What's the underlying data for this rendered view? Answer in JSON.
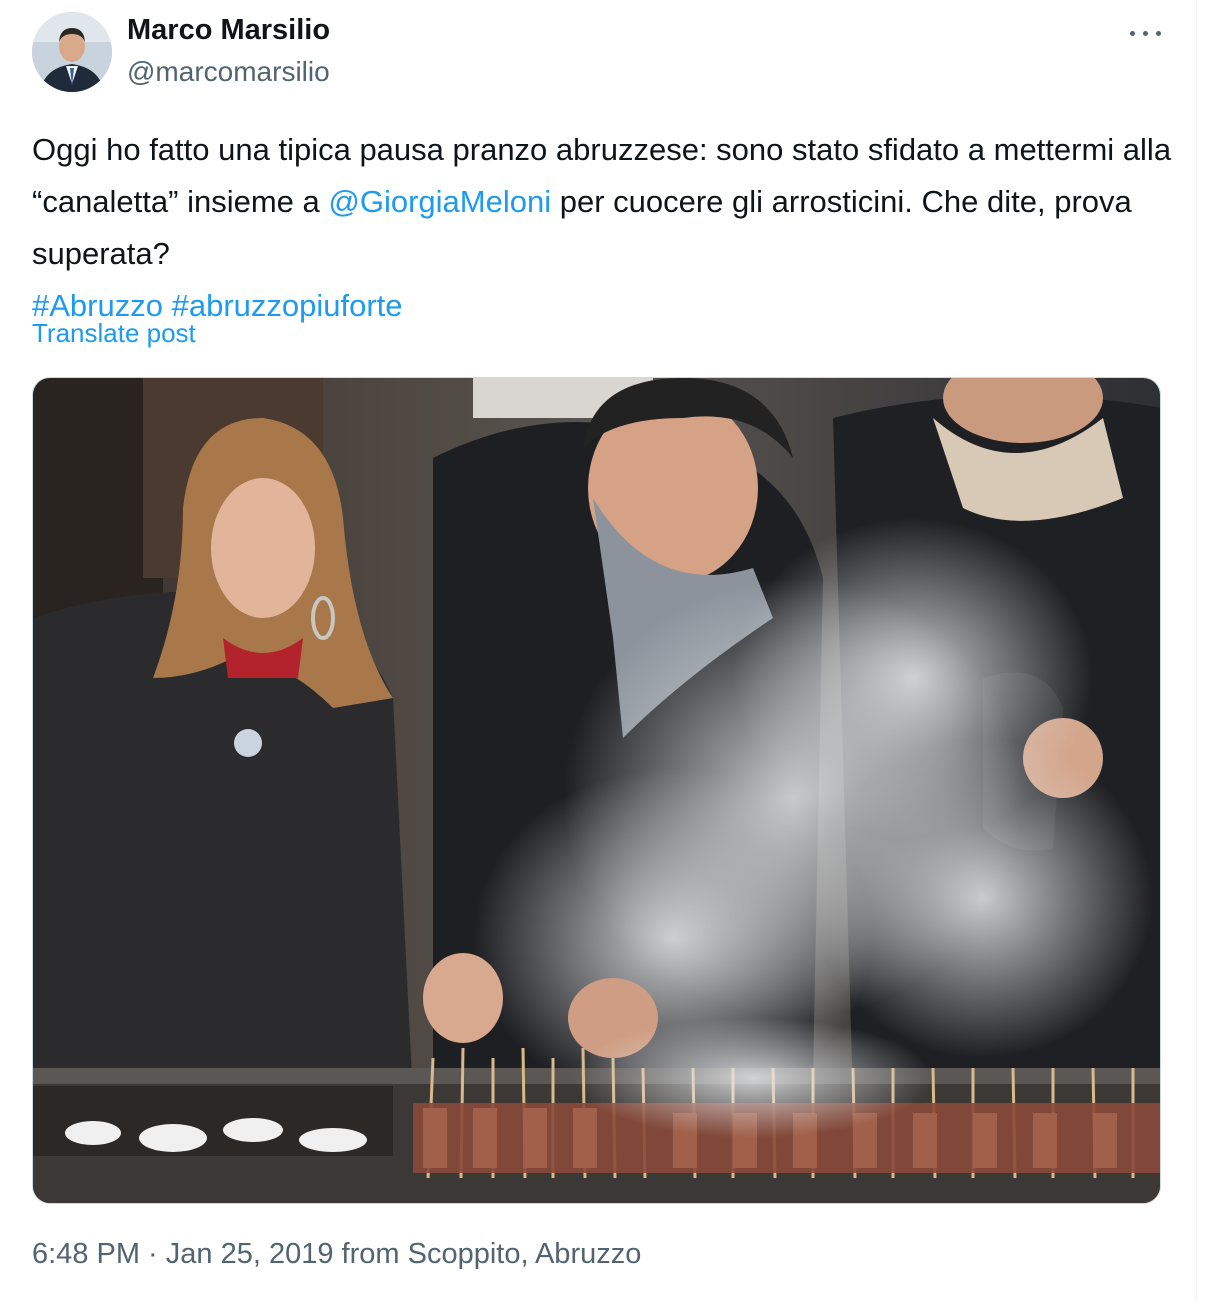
{
  "author": {
    "name": "Marco Marsilio",
    "handle": "@marcomarsilio"
  },
  "tweet": {
    "text_part1": "Oggi ho fatto una tipica pausa pranzo abruzzese: sono stato sfidato a mettermi alla “canaletta” insieme a ",
    "mention": "@GiorgiaMeloni",
    "text_part2": " per cuocere gli arrosticini. Che dite, prova superata?",
    "hashtag1": "#Abruzzo",
    "hashtag2": "#abruzzopiuforte",
    "translate_label": "Translate post"
  },
  "timestamp": {
    "time": "6:48 PM",
    "separator": " · ",
    "date": "Jan 25, 2019",
    "location": " from Scoppito, Abruzzo"
  },
  "icons": {
    "more": "more-dots-icon"
  },
  "colors": {
    "link": "#1d9bf0",
    "text": "#0f1419",
    "secondary": "#536471"
  }
}
